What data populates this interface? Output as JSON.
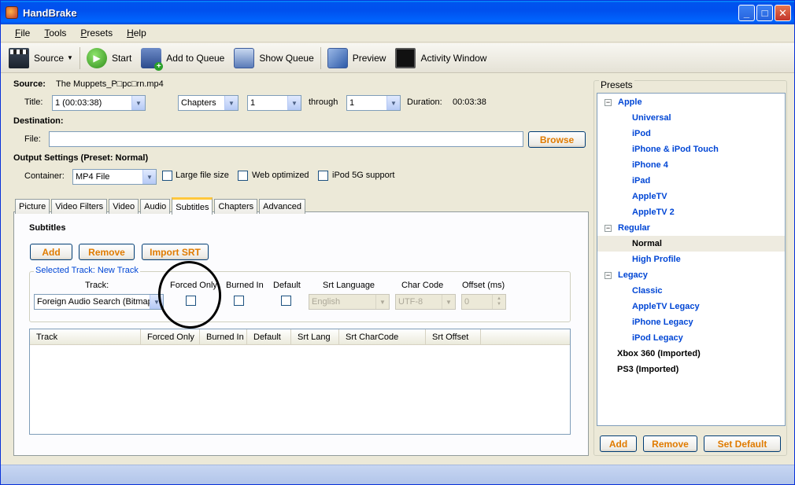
{
  "window": {
    "title": "HandBrake"
  },
  "menu": [
    {
      "prefix": "",
      "underline": "F",
      "rest": "ile"
    },
    {
      "prefix": "",
      "underline": "T",
      "rest": "ools"
    },
    {
      "prefix": "",
      "underline": "P",
      "rest": "resets"
    },
    {
      "prefix": "",
      "underline": "H",
      "rest": "elp"
    }
  ],
  "toolbar": {
    "source": "Source",
    "start": "Start",
    "add_to_queue": "Add to Queue",
    "show_queue": "Show Queue",
    "preview": "Preview",
    "activity_window": "Activity Window"
  },
  "source": {
    "label": "Source:",
    "filename": "The Muppets_P□pc□rn.mp4",
    "title_label": "Title:",
    "title_value": "1 (00:03:38)",
    "mode_value": "Chapters",
    "from_value": "1",
    "through_label": "through",
    "to_value": "1",
    "duration_label": "Duration:",
    "duration_value": "00:03:38"
  },
  "destination": {
    "label": "Destination:",
    "file_label": "File:",
    "file_value": "",
    "browse": "Browse"
  },
  "output": {
    "label": "Output Settings (Preset: Normal)",
    "container_label": "Container:",
    "container_value": "MP4 File",
    "large_file": "Large file size",
    "web_optimized": "Web optimized",
    "ipod_support": "iPod 5G support"
  },
  "tabs": [
    "Picture",
    "Video Filters",
    "Video",
    "Audio",
    "Subtitles",
    "Chapters",
    "Advanced"
  ],
  "active_tab": "Subtitles",
  "subtitles": {
    "heading": "Subtitles",
    "add": "Add",
    "remove": "Remove",
    "import_srt": "Import SRT",
    "group_title": "Selected Track: New Track",
    "track_label": "Track:",
    "track_value": "Foreign Audio Search (Bitmap)",
    "forced_only": "Forced Only",
    "burned_in": "Burned In",
    "default": "Default",
    "srt_language": "Srt Language",
    "srt_language_value": "English",
    "char_code": "Char Code",
    "char_code_value": "UTF-8",
    "offset": "Offset (ms)",
    "offset_value": "0",
    "columns": [
      "Track",
      "Forced Only",
      "Burned In",
      "Default",
      "Srt Lang",
      "Srt CharCode",
      "Srt Offset"
    ]
  },
  "presets": {
    "title": "Presets",
    "groups": [
      {
        "name": "Apple",
        "items": [
          "Universal",
          "iPod",
          "iPhone & iPod Touch",
          "iPhone 4",
          "iPad",
          "AppleTV",
          "AppleTV 2"
        ]
      },
      {
        "name": "Regular",
        "items": [
          "Normal",
          "High Profile"
        ]
      },
      {
        "name": "Legacy",
        "items": [
          "Classic",
          "AppleTV Legacy",
          "iPhone Legacy",
          "iPod Legacy"
        ]
      }
    ],
    "extra": [
      "Xbox 360 (Imported)",
      "PS3 (Imported)"
    ],
    "selected": "Normal",
    "add": "Add",
    "remove": "Remove",
    "set_default": "Set Default"
  },
  "colors": {
    "accent_orange": "#e07b00",
    "link_blue": "#0046d5",
    "titlebar": "#0053ee"
  }
}
